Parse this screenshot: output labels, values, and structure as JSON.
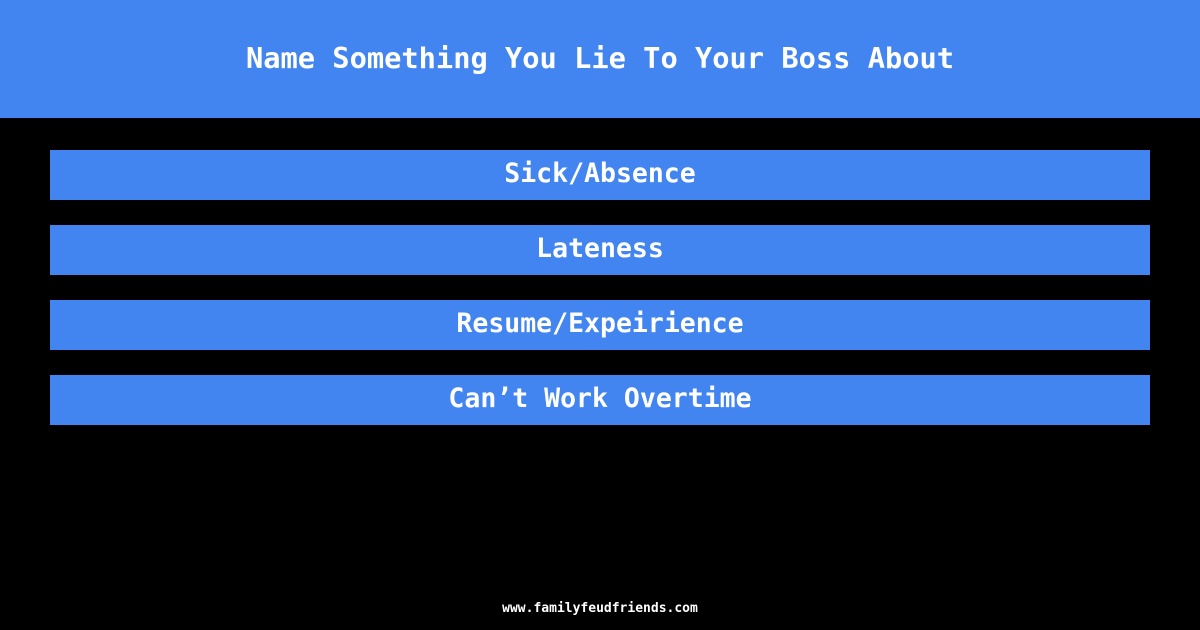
{
  "theme": {
    "background_color": "#000000",
    "accent_color": "#4285f0",
    "text_color": "#ffffff"
  },
  "header": {
    "title": "Name Something You Lie To Your Boss About"
  },
  "answers": [
    {
      "label": "Sick/Absence"
    },
    {
      "label": "Lateness"
    },
    {
      "label": "Resume/Expeirience"
    },
    {
      "label": "Can’t Work Overtime"
    }
  ],
  "footer": {
    "url": "www.familyfeudfriends.com"
  }
}
